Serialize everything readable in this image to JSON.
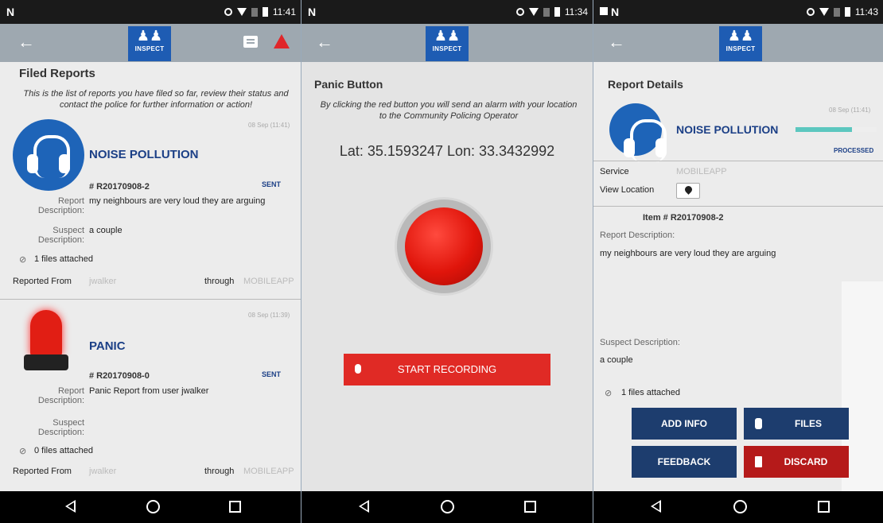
{
  "screens": [
    {
      "statusbar": {
        "carrier": "N",
        "time": "11:41"
      },
      "toolbar": {
        "logo_text": "INSPECT",
        "logo_glyph": "♟♟"
      },
      "title": "Filed Reports",
      "intro": "This is the list of reports you have filed so far, review their status and contact the police for further information or action!",
      "reports": [
        {
          "stamp": "08 Sep (11:41)",
          "title": "NOISE POLLUTION",
          "ref": "# R20170908-2",
          "status": "SENT",
          "report_label": "Report Description:",
          "report_value": "my neighbours are very loud they are arguing",
          "suspect_label": "Suspect Description:",
          "suspect_value": "a couple",
          "files": "1 files attached",
          "reported_from_label": "Reported From",
          "reported_from_value": "jwalker",
          "through_label": "through",
          "through_value": "MOBILEAPP"
        },
        {
          "stamp": "08 Sep (11:39)",
          "title": "PANIC",
          "ref": "# R20170908-0",
          "status": "SENT",
          "report_label": "Report Description:",
          "report_value": "Panic Report from user jwalker",
          "suspect_label": "Suspect Description:",
          "suspect_value": "",
          "files": "0 files attached",
          "reported_from_label": "Reported From",
          "reported_from_value": "jwalker",
          "through_label": "through",
          "through_value": "MOBILEAPP"
        }
      ]
    },
    {
      "statusbar": {
        "carrier": "N",
        "time": "11:34"
      },
      "toolbar": {
        "logo_text": "INSPECT",
        "logo_glyph": "♟♟"
      },
      "title": "Panic Button",
      "intro": "By clicking the red button you will send an alarm with your location to the Community Policing Operator",
      "coords": "Lat: 35.1593247 Lon: 33.3432992",
      "record_label": "START RECORDING"
    },
    {
      "statusbar": {
        "carrier": "N",
        "time": "11:43"
      },
      "toolbar": {
        "logo_text": "INSPECT",
        "logo_glyph": "♟♟"
      },
      "title": "Report Details",
      "stamp": "08 Sep (11:41)",
      "report_title": "NOISE POLLUTION",
      "status": "PROCESSED",
      "progress": 0.7,
      "service_label": "Service",
      "service_value": "MOBILEAPP",
      "view_location_label": "View Location",
      "item": "Item # R20170908-2",
      "report_desc_label": "Report Description:",
      "report_desc_value": "my neighbours are very loud they are arguing",
      "suspect_desc_label": "Suspect Description:",
      "suspect_desc_value": "a couple",
      "files": "1 files attached",
      "buttons": {
        "add_info": "ADD INFO",
        "files": "FILES",
        "feedback": "FEEDBACK",
        "discard": "DISCARD"
      }
    }
  ],
  "colors": {
    "brand_blue": "#1e5cb3",
    "title_blue": "#1b3f86",
    "alert_red": "#e02a25",
    "toolbar": "#9ea8b0",
    "progress": "#5cc7bf"
  }
}
